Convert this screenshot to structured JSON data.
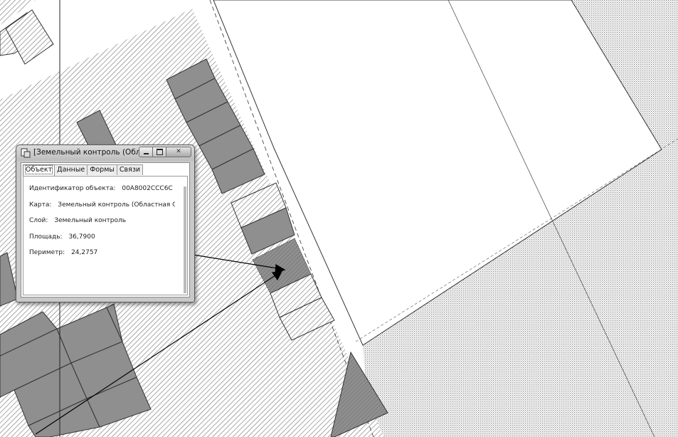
{
  "window": {
    "title": "[Земельный контроль (Областн...",
    "controls": {
      "minimize": "minimize-icon",
      "maximize": "maximize-icon",
      "close": "✕"
    }
  },
  "tabs": [
    "Объект",
    "Данные",
    "Формы",
    "Связи"
  ],
  "active_tab": 0,
  "fields": {
    "id_label": "Идентификатор объекта:",
    "id_value": "00A8002CCC6C",
    "map_label": "Карта:",
    "map_value": "Земельный контроль (Областная СК",
    "layer_label": "Слой:",
    "layer_value": "Земельный контроль",
    "area_label": "Площадь:",
    "area_value": "36,7900",
    "perimeter_label": "Периметр:",
    "perimeter_value": "24,2757"
  },
  "colors": {
    "hatch_line": "#7a7a7a",
    "parcel_fill": "#8f8f8f",
    "selected_fill": "#6c6c6c",
    "dots": "#9a9a9a"
  }
}
